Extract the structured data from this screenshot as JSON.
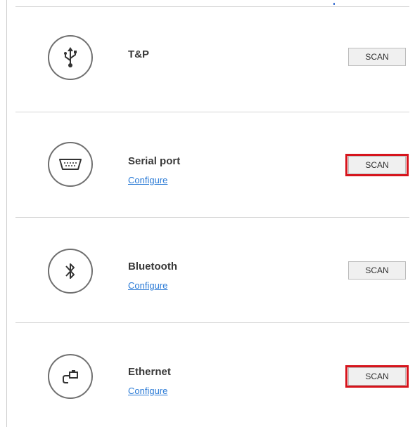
{
  "devices": [
    {
      "name": "T&P",
      "icon": "usb-icon",
      "configure": null,
      "scan_label": "SCAN",
      "highlighted": false
    },
    {
      "name": "Serial port",
      "icon": "serial-port-icon",
      "configure": "Configure",
      "scan_label": "SCAN",
      "highlighted": true
    },
    {
      "name": "Bluetooth",
      "icon": "bluetooth-icon",
      "configure": "Configure",
      "scan_label": "SCAN",
      "highlighted": false
    },
    {
      "name": "Ethernet",
      "icon": "ethernet-icon",
      "configure": "Configure",
      "scan_label": "SCAN",
      "highlighted": true
    }
  ],
  "colors": {
    "highlight": "#d6141c",
    "link": "#2a7ad6",
    "divider": "#d4d4d4"
  }
}
